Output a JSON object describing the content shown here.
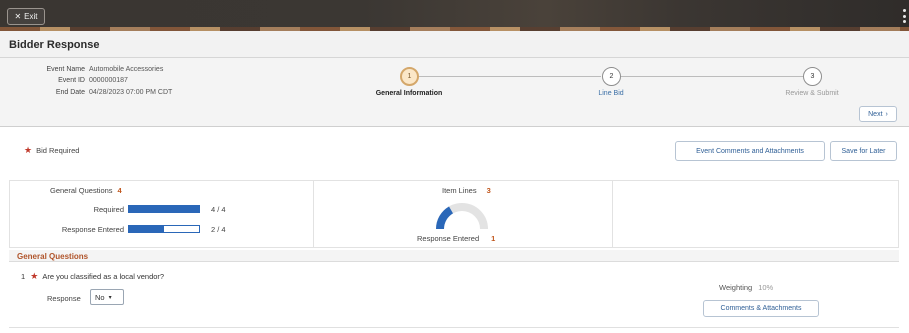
{
  "header": {
    "exit_label": "Exit",
    "exit_icon": "close-icon",
    "page_title": "Bidder Response"
  },
  "event": {
    "name_label": "Event Name",
    "name_value": "Automobile Accessories",
    "id_label": "Event ID",
    "id_value": "0000000187",
    "end_label": "End Date",
    "end_value": "04/28/2023 07:00 PM CDT"
  },
  "steps": [
    {
      "number": "1",
      "label": "General Information",
      "state": "active"
    },
    {
      "number": "2",
      "label": "Line Bid",
      "state": "link"
    },
    {
      "number": "3",
      "label": "Review & Submit",
      "state": "muted"
    }
  ],
  "actions": {
    "next_label": "Next",
    "event_comments_label": "Event Comments and Attachments",
    "save_later_label": "Save for Later"
  },
  "bid_required_label": "Bid Required",
  "summary": {
    "general_questions_label": "General Questions",
    "general_questions_count": "4",
    "required_label": "Required",
    "required_text": "4 / 4",
    "required_fraction": 1.0,
    "response_entered_label": "Response Entered",
    "response_entered_text": "2 / 4",
    "response_entered_fraction": 0.5,
    "item_lines_label": "Item Lines",
    "item_lines_count": "3",
    "lines_response_label": "Response Entered",
    "lines_response_count": "1",
    "lines_response_fraction": 0.3333
  },
  "questions_section": {
    "title": "General Questions",
    "question_number": "1",
    "question_text": "Are you classified as a local vendor?",
    "response_label": "Response",
    "response_value": "No",
    "weighting_label": "Weighting",
    "weighting_value": "10%",
    "comments_label": "Comments & Attachments"
  },
  "colors": {
    "accent_blue": "#2a67b8",
    "required_red": "#c0392b",
    "section_orange": "#b0542a",
    "active_step": "#d4a76a"
  }
}
